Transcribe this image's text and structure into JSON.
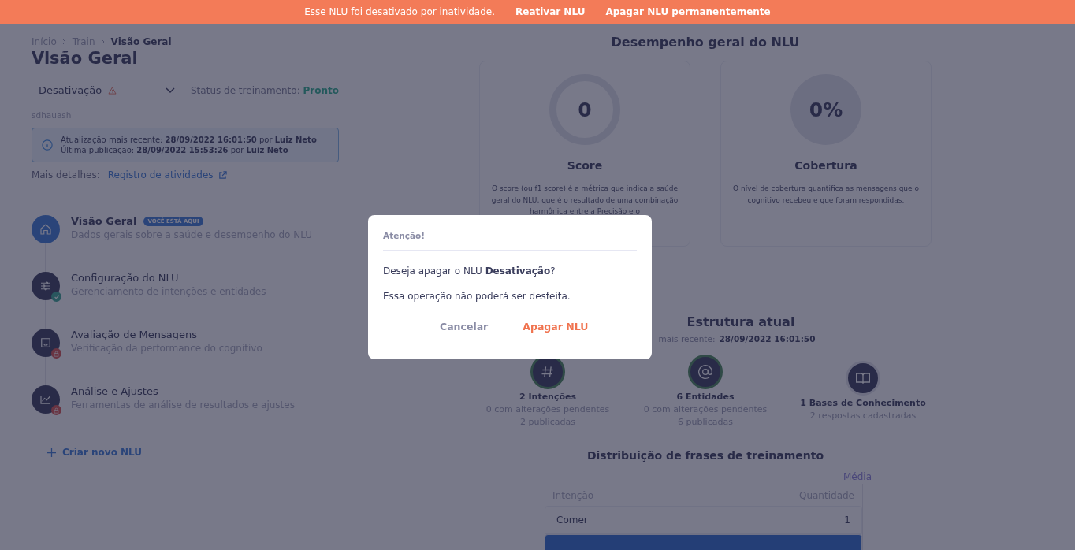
{
  "banner": {
    "message": "Esse NLU foi desativado por inatividade.",
    "actions": [
      "Reativar NLU",
      "Apagar NLU permanentemente"
    ]
  },
  "breadcrumb": [
    {
      "label": "Início",
      "current": false
    },
    {
      "label": "Train",
      "current": false
    },
    {
      "label": "Visão Geral",
      "current": true
    }
  ],
  "title": "Visão Geral",
  "nlu_select": {
    "value": "Desativação",
    "warning": true
  },
  "training_status": {
    "label": "Status de treinamento:",
    "value": "Pronto"
  },
  "description": "sdhauash",
  "info_box": {
    "lines": [
      "Atualização mais recente: **28/09/2022 16:01:50** por **Luiz Neto**",
      "Última publicação: **28/09/2022 15:53:26** por **Luiz Neto**"
    ]
  },
  "more_details": {
    "label": "Mais detalhes:",
    "link": "Registro de atividades"
  },
  "steps": [
    {
      "kind": "overview",
      "title": "Visão Geral",
      "badge": "VOCÊ ESTÁ AQUI",
      "subtitle": "Dados gerais sobre a saúde e desempenho do NLU",
      "selected": true,
      "done": false,
      "locked": false
    },
    {
      "kind": "config",
      "title": "Configuração do NLU",
      "subtitle": "Gerenciamento de intenções e entidades",
      "selected": false,
      "done": true,
      "locked": false
    },
    {
      "kind": "messages",
      "title": "Avaliação de Mensagens",
      "subtitle": "Verificação da performance do cognitivo",
      "selected": false,
      "done": false,
      "locked": true
    },
    {
      "kind": "analysis",
      "title": "Análise e Ajustes",
      "subtitle": "Ferramentas de análise de resultados e ajustes",
      "selected": false,
      "done": false,
      "locked": true
    }
  ],
  "create_button": "Criar novo NLU",
  "performance": {
    "title": "Desempenho geral do NLU",
    "cards": [
      {
        "kind": "ring",
        "value": "0",
        "title": "Score",
        "description": "O score (ou f1 score) é a métrica que indica a saúde geral do NLU, que é o resultado de uma combinação harmônica entre a Precisão e o"
      },
      {
        "kind": "disc",
        "value": "0%",
        "title": "Cobertura",
        "description": "O nível de cobertura quantifica as mensagens que o cognitivo recebeu e que foram respondidas."
      }
    ]
  },
  "structure": {
    "title": "Estrutura atual",
    "subtitle_label": "mais recente:",
    "subtitle_value": "28/09/2022 16:01:50",
    "items": [
      {
        "kind": "intents",
        "complete": true,
        "title": "2 Intenções",
        "lines": [
          "0 com alterações pendentes",
          "2 publicadas"
        ]
      },
      {
        "kind": "entities",
        "complete": true,
        "title": "6 Entidades",
        "lines": [
          "0 com alterações pendentes",
          "6 publicadas"
        ]
      },
      {
        "kind": "knowledge",
        "complete": false,
        "title": "1 Bases de Conhecimento",
        "lines": [
          "2 respostas cadastradas"
        ]
      }
    ]
  },
  "distribution": {
    "title": "Distribuição de frases de treinamento",
    "toggle": "Média",
    "columns": [
      "Intenção",
      "Quantidade"
    ],
    "rows": [
      {
        "cells": [
          "Comer",
          "1"
        ],
        "selected": false
      },
      {
        "cells": [],
        "selected": true
      }
    ]
  },
  "dialog": {
    "title": "Atenção!",
    "message": "Deseja apagar o NLU **Desativação**?",
    "note": "Essa operação não poderá ser desfeita.",
    "buttons": [
      {
        "label": "Cancelar",
        "kind": "secondary"
      },
      {
        "label": "Apagar NLU",
        "kind": "danger"
      }
    ]
  }
}
